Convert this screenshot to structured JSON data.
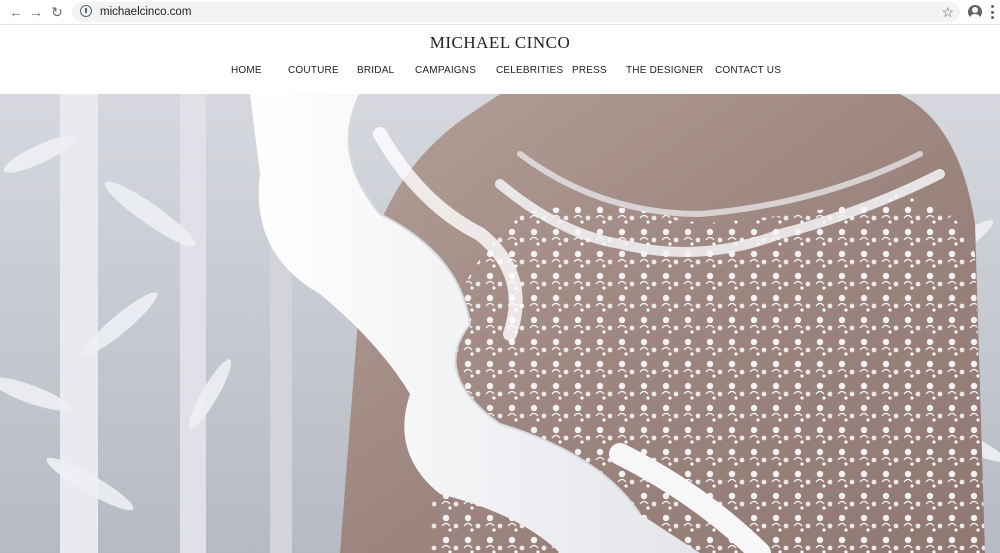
{
  "browser": {
    "url": "michaelcinco.com",
    "back_icon": "arrow-left-icon",
    "forward_icon": "arrow-right-icon",
    "reload_icon": "reload-icon",
    "info_icon": "info-icon",
    "bookmark_icon": "star-icon",
    "profile_icon": "account-icon",
    "menu_icon": "more-vert-icon"
  },
  "site": {
    "logo": "MICHAEL CINCO",
    "nav": [
      "HOME",
      "COUTURE",
      "BRIDAL",
      "CAMPAIGNS",
      "CELEBRITIES",
      "PRESS",
      "THE DESIGNER",
      "CONTACT US"
    ]
  },
  "hero": {
    "image": "bridal-gown-photo",
    "colors": {
      "background": "#c9ccd3",
      "skin": "#a28a84",
      "fabric": "#f4f4f6"
    }
  }
}
